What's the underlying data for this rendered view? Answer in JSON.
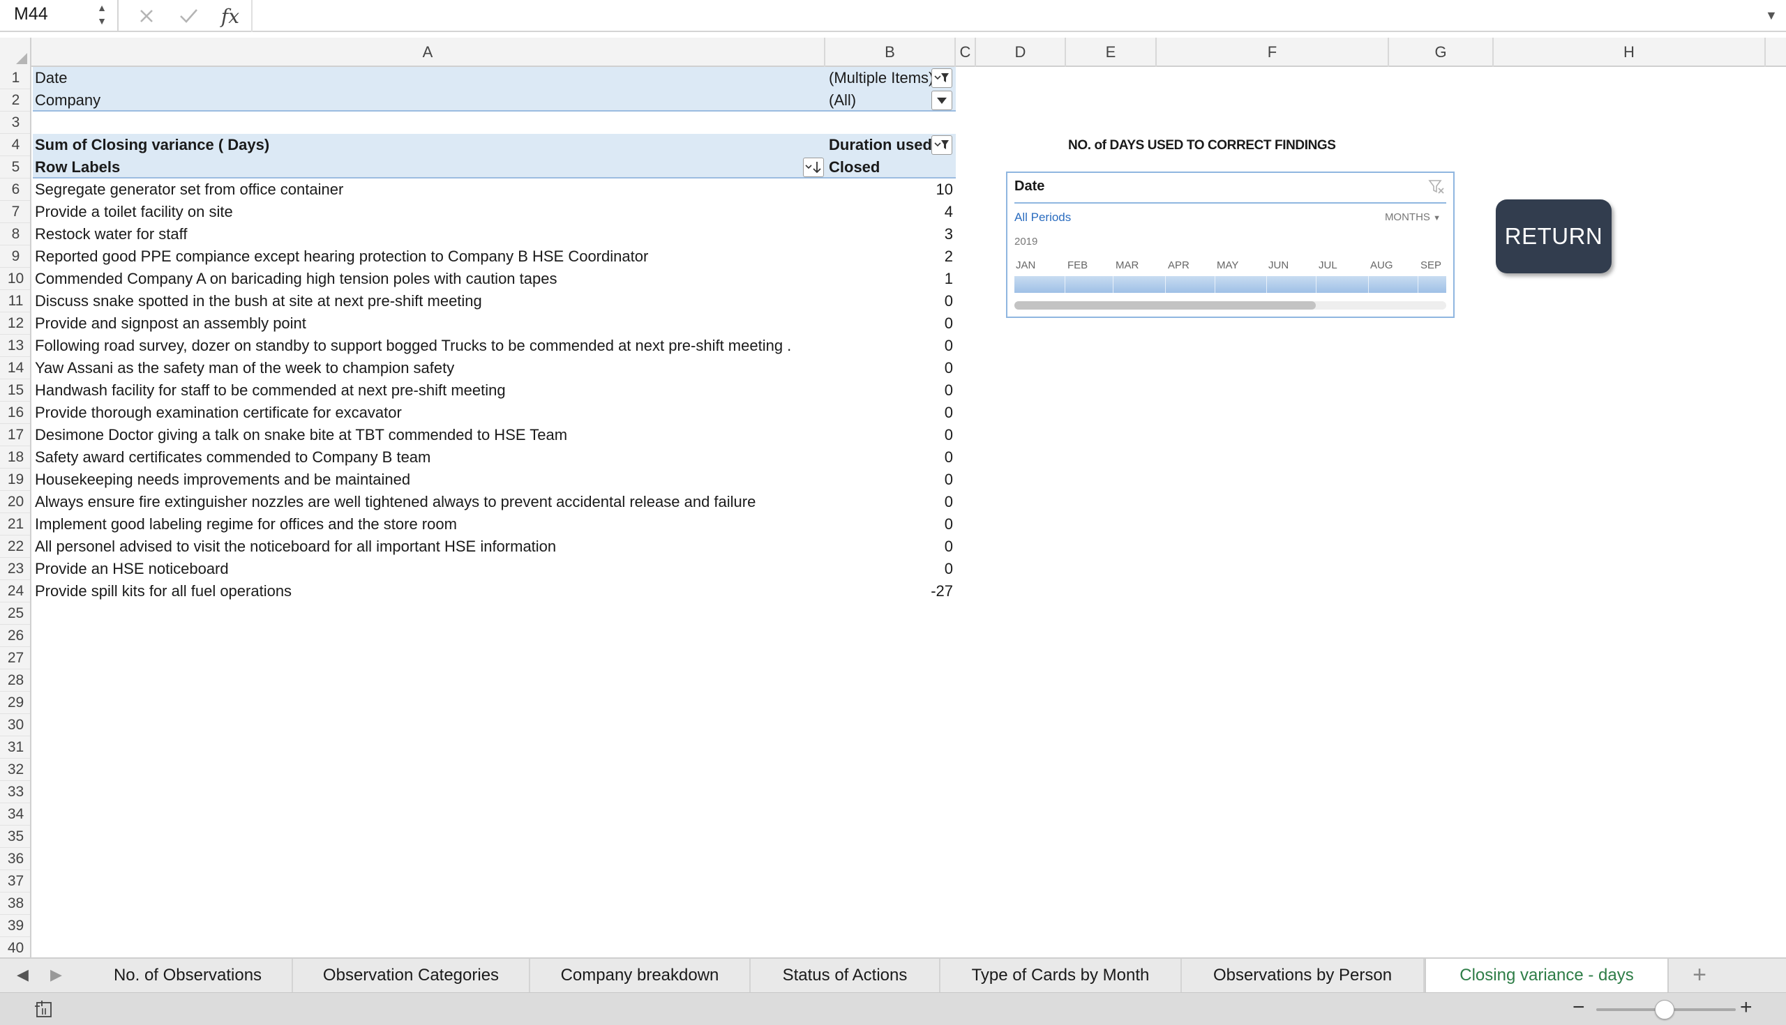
{
  "formula_bar": {
    "name_box": "M44",
    "cancel_icon": "cancel-icon",
    "enter_icon": "check-icon",
    "function_label": "fx",
    "formula": ""
  },
  "columns": [
    "A",
    "B",
    "C",
    "D",
    "E",
    "F",
    "G",
    "H"
  ],
  "rows": [
    "1",
    "2",
    "3",
    "4",
    "5",
    "6",
    "7",
    "8",
    "9",
    "10",
    "11",
    "12",
    "13",
    "14",
    "15",
    "16",
    "17",
    "18",
    "19",
    "20",
    "21",
    "22",
    "23",
    "24",
    "25",
    "26",
    "27",
    "28",
    "29",
    "30",
    "31",
    "32",
    "33",
    "34",
    "35",
    "36",
    "37",
    "38",
    "39",
    "40"
  ],
  "pivot": {
    "filters": [
      {
        "label": "Date",
        "value": "(Multiple Items)"
      },
      {
        "label": "Company",
        "value": "(All)"
      }
    ],
    "values_label": "Sum of Closing variance ( Days)",
    "column_field": "Duration used",
    "row_labels_header": "Row Labels",
    "column_item": "Closed",
    "items": [
      {
        "label": "Segregate generator set from office container",
        "value": "10"
      },
      {
        "label": "Provide a toilet facility on site",
        "value": "4"
      },
      {
        "label": "Restock water for staff",
        "value": "3"
      },
      {
        "label": "Reported good PPE compiance except hearing protection to  Company B HSE Coordinator",
        "value": "2"
      },
      {
        "label": "Commended Company A on baricading high tension poles with caution tapes",
        "value": "1"
      },
      {
        "label": "Discuss snake spotted in the bush at  site at next pre-shift meeting",
        "value": "0"
      },
      {
        "label": "Provide and signpost an assembly point",
        "value": "0"
      },
      {
        "label": "Following road survey, dozer on standby to support bogged Trucks to be commended at next pre-shift meeting .",
        "value": "0"
      },
      {
        "label": "Yaw Assani as the safety man of the week to champion safety",
        "value": "0"
      },
      {
        "label": "Handwash facility for staff to be commended at next pre-shift meeting",
        "value": "0"
      },
      {
        "label": "Provide thorough examination certificate for excavator",
        "value": "0"
      },
      {
        "label": "Desimone Doctor giving a talk on snake bite at TBT commended to HSE Team",
        "value": "0"
      },
      {
        "label": "Safety award certificates commended to  Company B team",
        "value": "0"
      },
      {
        "label": "Housekeeping needs improvements and be maintained",
        "value": "0"
      },
      {
        "label": "Always ensure fire extinguisher nozzles are well tightened always to prevent accidental release and failure",
        "value": "0"
      },
      {
        "label": "Implement good labeling regime for offices and the store room",
        "value": "0"
      },
      {
        "label": "All personel advised to visit the noticeboard for all important HSE information",
        "value": "0"
      },
      {
        "label": "Provide an HSE noticeboard",
        "value": "0"
      },
      {
        "label": "Provide spill kits for all fuel operations",
        "value": "-27"
      }
    ]
  },
  "slicer": {
    "title": "NO. of DAYS USED TO CORRECT FINDINGS",
    "header": "Date",
    "periods_label": "All Periods",
    "level_label": "MONTHS",
    "year": "2019",
    "months": [
      "JAN",
      "FEB",
      "MAR",
      "APR",
      "MAY",
      "JUN",
      "JUL",
      "AUG",
      "SEP"
    ]
  },
  "return_button": "RETURN",
  "sheet_tabs": [
    "No. of Observations",
    "Observation Categories",
    "Company breakdown",
    "Status of Actions",
    "Type of Cards by Month",
    "Observations by Person",
    "Closing variance - days"
  ],
  "active_tab": "Closing variance - days",
  "colors": {
    "pivot_band": "#dce9f5",
    "active_tab_text": "#2e7d47",
    "return_button_bg": "#323d4e",
    "slicer_border": "#8fb6e0"
  }
}
